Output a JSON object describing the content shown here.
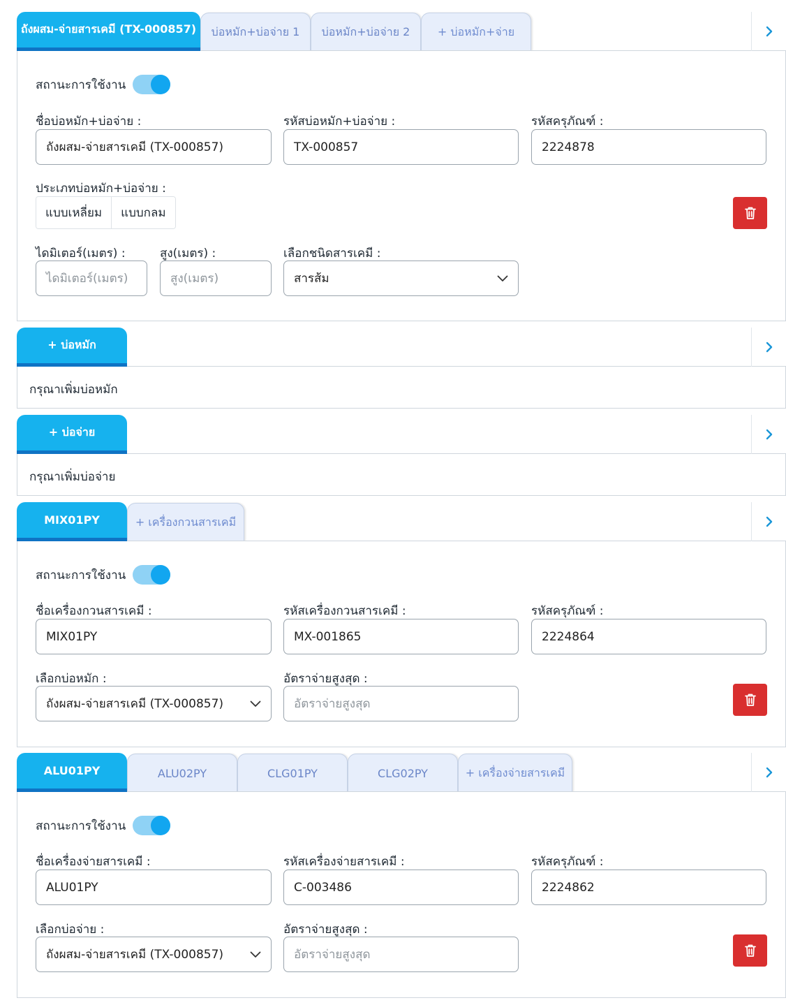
{
  "section_pond": {
    "tabs": [
      {
        "label": "ถังผสม-จ่ายสารเคมี (TX-000857)"
      },
      {
        "label": "บ่อหมัก+บ่อจ่าย 1"
      },
      {
        "label": "บ่อหมัก+บ่อจ่าย 2"
      },
      {
        "label": "+ บ่อหมัก+จ่าย"
      }
    ],
    "status_label": "สถานะการใช้งาน",
    "name_label": "ชื่อบ่อหมัก+บ่อจ่าย :",
    "name_value": "ถังผสม-จ่ายสารเคมี (TX-000857)",
    "code_label": "รหัสบ่อหมัก+บ่อจ่าย :",
    "code_value": "TX-000857",
    "asset_label": "รหัสครุภัณฑ์ :",
    "asset_value": "2224878",
    "type_label": "ประเภทบ่อหมัก+บ่อจ่าย :",
    "type_options": [
      "แบบเหลี่ยม",
      "แบบกลม"
    ],
    "diameter_label": "ไดมิเตอร์(เมตร) :",
    "diameter_placeholder": "ไดมิเตอร์(เมตร)",
    "height_label": "สูง(เมตร) :",
    "height_placeholder": "สูง(เมตร)",
    "chemical_label": "เลือกชนิดสารเคมี :",
    "chemical_value": "สารส้ม"
  },
  "section_ferment": {
    "tab": "+ บ่อหมัก",
    "message": "กรุณาเพิ่มบ่อหมัก"
  },
  "section_dispense": {
    "tab": "+ บ่อจ่าย",
    "message": "กรุณาเพิ่มบ่อจ่าย"
  },
  "section_mixer": {
    "tabs": [
      {
        "label": "MIX01PY"
      },
      {
        "label": "+ เครื่องกวนสารเคมี"
      }
    ],
    "status_label": "สถานะการใช้งาน",
    "name_label": "ชื่อเครื่องกวนสารเคมี :",
    "name_value": "MIX01PY",
    "code_label": "รหัสเครื่องกวนสารเคมี :",
    "code_value": "MX-001865",
    "asset_label": "รหัสครุภัณฑ์ :",
    "asset_value": "2224864",
    "pond_label": "เลือกบ่อหมัก :",
    "pond_value": "ถังผสม-จ่ายสารเคมี (TX-000857)",
    "rate_label": "อัตราจ่ายสูงสุด :",
    "rate_placeholder": "อัตราจ่ายสูงสุด"
  },
  "section_doser": {
    "tabs": [
      {
        "label": "ALU01PY"
      },
      {
        "label": "ALU02PY"
      },
      {
        "label": "CLG01PY"
      },
      {
        "label": "CLG02PY"
      },
      {
        "label": "+ เครื่องจ่ายสารเคมี"
      }
    ],
    "status_label": "สถานะการใช้งาน",
    "name_label": "ชื่อเครื่องจ่ายสารเคมี :",
    "name_value": "ALU01PY",
    "code_label": "รหัสเครื่องจ่ายสารเคมี :",
    "code_value": "C-003486",
    "asset_label": "รหัสครุภัณฑ์ :",
    "asset_value": "2224862",
    "pond_label": "เลือกบ่อจ่าย :",
    "pond_value": "ถังผสม-จ่ายสารเคมี (TX-000857)",
    "rate_label": "อัตราจ่ายสูงสุด :",
    "rate_placeholder": "อัตราจ่ายสูงสุด"
  },
  "colors": {
    "active_tab": "#16b2ee",
    "active_tab_underline": "#0f73c4",
    "inactive_tab": "#e7eefb",
    "toggle_on": "#12a6f0",
    "delete_button": "#d92f2f"
  },
  "icons": {
    "nav": "chevron-right-icon",
    "delete": "trash-icon",
    "dropdown": "chevron-down-icon"
  }
}
